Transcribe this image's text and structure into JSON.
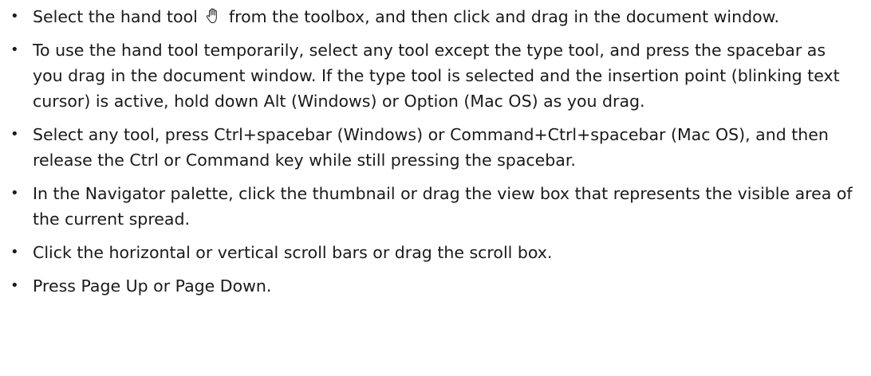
{
  "items": [
    {
      "before_icon": "Select the hand tool",
      "icon": "hand-icon",
      "after_icon": "from the toolbox, and then click and drag in the document window."
    },
    {
      "text": "To use the hand tool temporarily, select any tool except the type tool, and press the spacebar as you drag in the document window. If the type tool is selected and the insertion point (blinking text cursor) is active, hold down Alt (Windows) or Option (Mac OS) as you drag."
    },
    {
      "text": "Select any tool, press Ctrl+spacebar (Windows) or Command+Ctrl+spacebar (Mac OS), and then release the Ctrl or Command key while still pressing the spacebar."
    },
    {
      "text": "In the Navigator palette, click the thumbnail or drag the view box that represents the visible area of the current spread."
    },
    {
      "text": "Click the horizontal or vertical scroll bars or drag the scroll box."
    },
    {
      "text": "Press Page Up or Page Down."
    }
  ]
}
